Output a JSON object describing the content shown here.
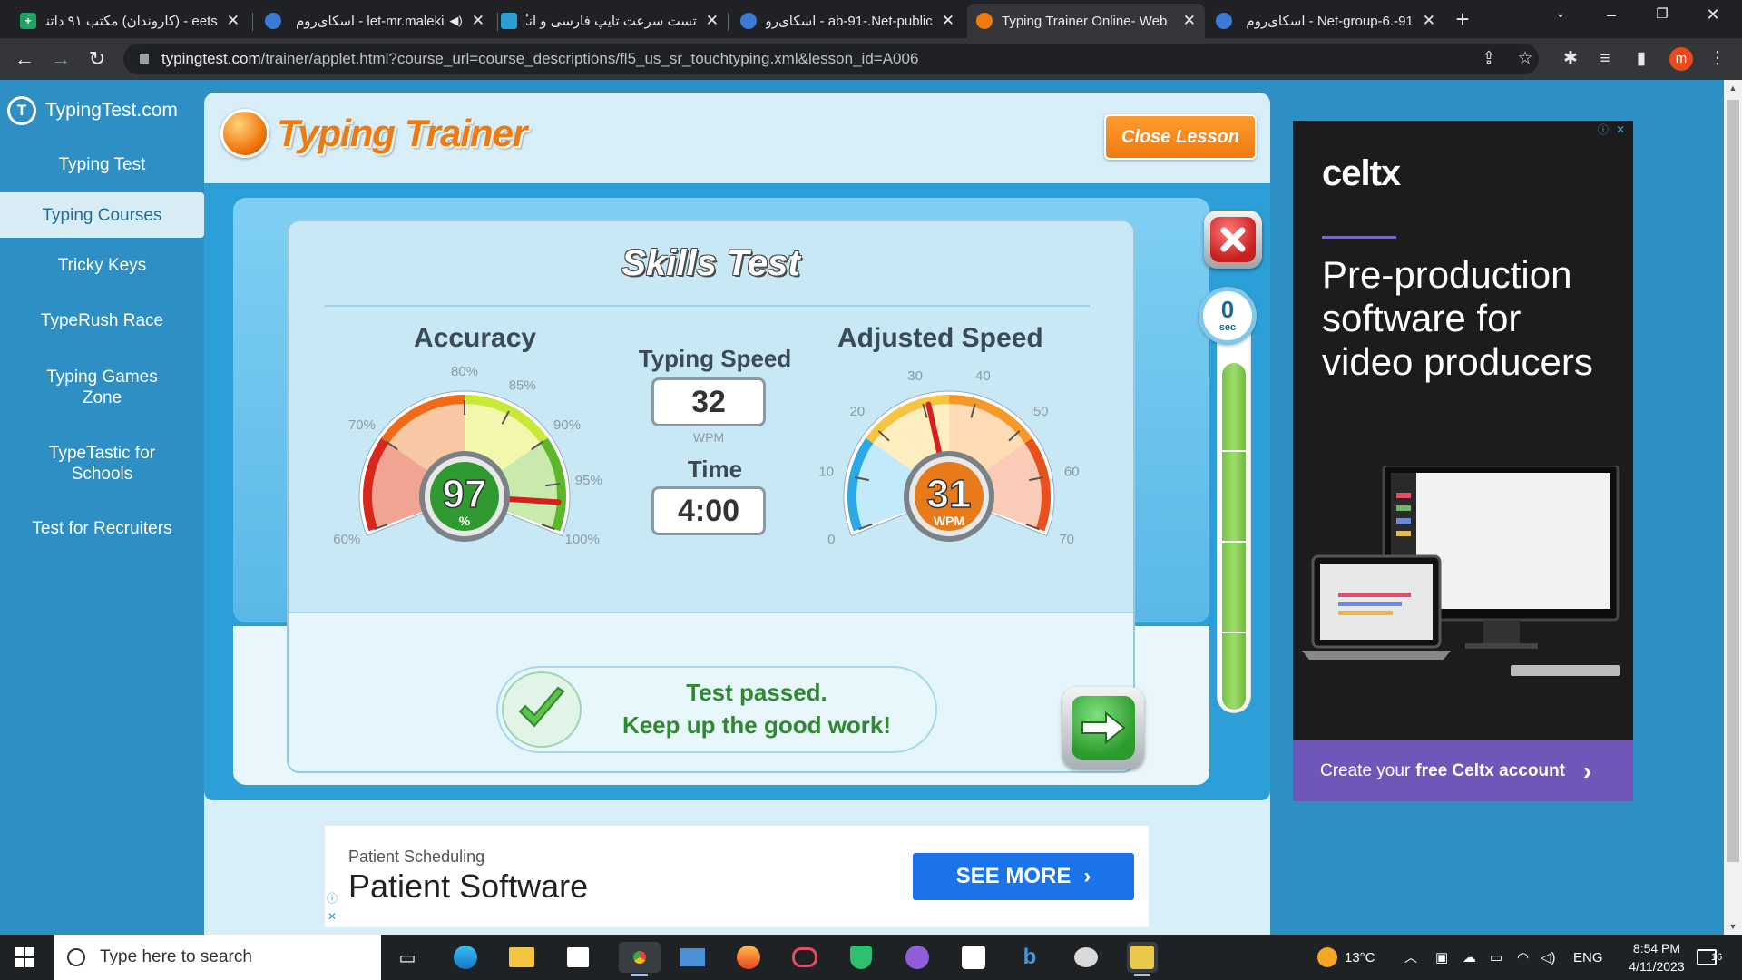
{
  "browser": {
    "tabs": [
      {
        "title": "eets - (کاروندان) مکتب ۹۱ داتنت",
        "icon": "sheets-icon",
        "color": "#1ea362",
        "active": false
      },
      {
        "title": "let-mr.maleki - اسکای‌روم",
        "icon": "skyroom-icon",
        "color": "#3a7bd5",
        "active": false,
        "audio": true
      },
      {
        "title": "تست سرعت تایپ فارسی و انگلیسی",
        "icon": "typing-site-icon",
        "color": "#2a9fd6",
        "active": false
      },
      {
        "title": "ab-91-.Net-public - اسکای‌روم",
        "icon": "skyroom-icon",
        "color": "#3a7bd5",
        "active": false
      },
      {
        "title": "Typing Trainer Online- Web",
        "icon": "typingtest-icon",
        "color": "#f07a10",
        "active": true
      },
      {
        "title": "91-.Net-group-6 - اسکای‌روم",
        "icon": "skyroom-icon",
        "color": "#3a7bd5",
        "active": false
      }
    ],
    "url_host": "typingtest.com",
    "url_path": "/trainer/applet.html?course_url=course_descriptions/fl5_us_sr_touchtyping.xml&lesson_id=A006",
    "profile_initial": "m"
  },
  "site": {
    "logo_text": "TypingTest.com",
    "nav": [
      {
        "label": "Typing Test",
        "active": false
      },
      {
        "label": "Typing Courses",
        "active": true
      },
      {
        "label": "Tricky Keys",
        "active": false
      },
      {
        "label": "TypeRush Race",
        "active": false
      },
      {
        "label": "Typing Games Zone",
        "active": false
      },
      {
        "label": "TypeTastic for Schools",
        "active": false
      },
      {
        "label": "Test for Recruiters",
        "active": false
      }
    ]
  },
  "trainer": {
    "logo_text": "Typing Trainer",
    "close_lesson_label": "Close Lesson",
    "skills_title": "Skills Test",
    "accuracy": {
      "title": "Accuracy",
      "value": 97,
      "unit": "%",
      "ticks": [
        "60%",
        "70%",
        "80%",
        "85%",
        "90%",
        "95%",
        "100%"
      ],
      "min": 60,
      "max": 100
    },
    "typing_speed": {
      "label": "Typing Speed",
      "value": "32",
      "unit": "WPM"
    },
    "time": {
      "label": "Time",
      "value": "4:00"
    },
    "adjusted_speed": {
      "title": "Adjusted Speed",
      "value": 31,
      "unit": "WPM",
      "ticks": [
        "0",
        "10",
        "20",
        "30",
        "40",
        "50",
        "60",
        "70"
      ],
      "min": 0,
      "max": 70
    },
    "result_line1": "Test passed.",
    "result_line2": "Keep up the good work!",
    "timer": {
      "value": "0",
      "unit": "sec",
      "fraction": 1.0
    }
  },
  "ads": {
    "bottom": {
      "kicker": "Patient Scheduling",
      "title": "Patient Software",
      "cta": "SEE MORE"
    },
    "side": {
      "brand": "celtx",
      "headline": "Pre-production software for video producers",
      "footer_prefix": "Create your",
      "footer_bold": "free Celtx account"
    }
  },
  "taskbar": {
    "search_placeholder": "Type here to search",
    "weather": "13°C",
    "language": "ENG",
    "time": "8:54 PM",
    "date": "4/11/2023",
    "notification_count": "16"
  }
}
